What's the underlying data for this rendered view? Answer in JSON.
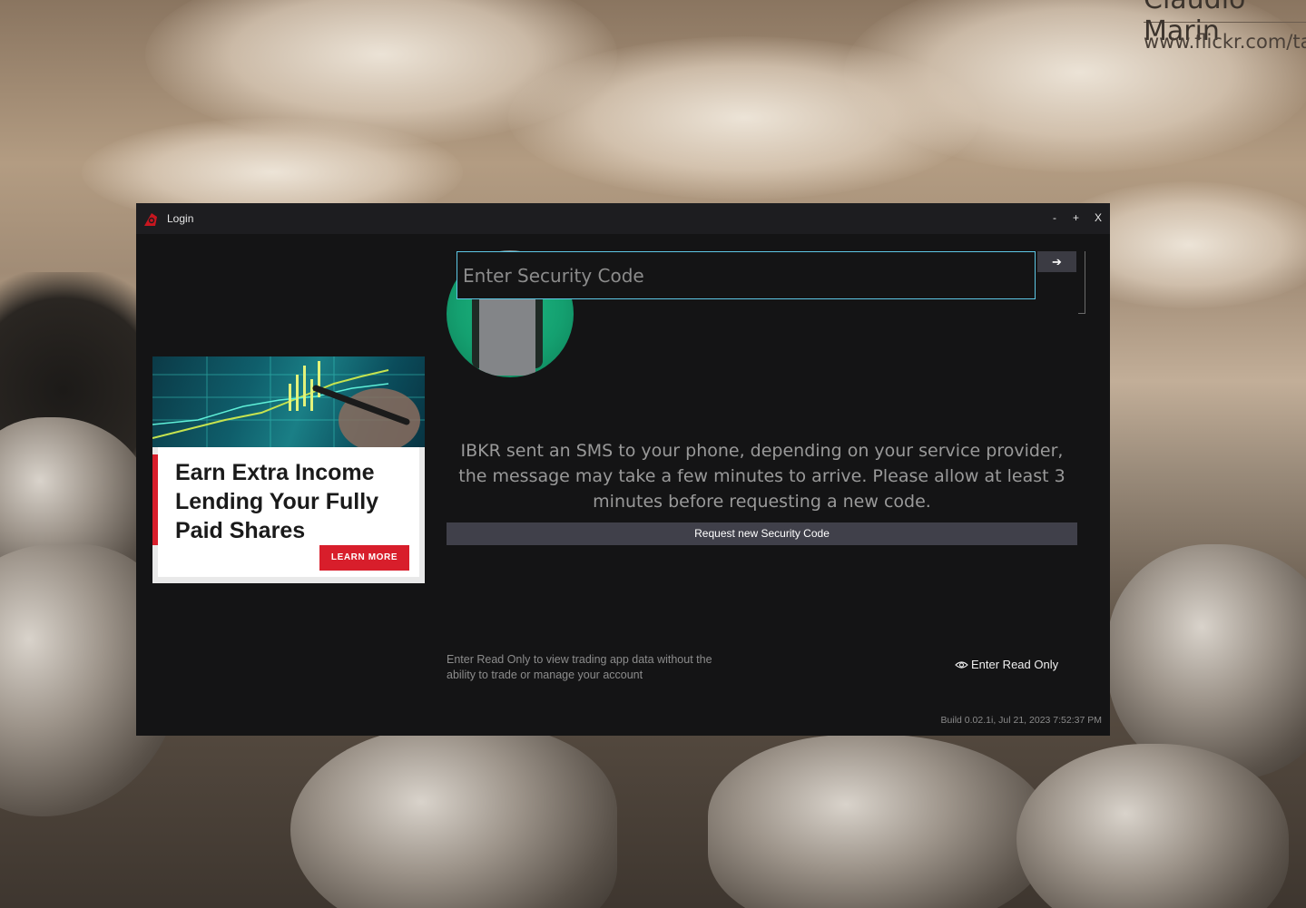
{
  "wallpaper": {
    "credit_name": "Claudio Marin",
    "credit_url": "www.flickr.com/ta"
  },
  "window": {
    "title": "Login",
    "logo_icon": "ibkr-logo-icon",
    "controls": {
      "minimize": "-",
      "maximize": "+",
      "close": "X"
    }
  },
  "ad": {
    "headline": "Earn Extra Income Lending Your Fully Paid Shares",
    "cta": "LEARN MORE",
    "accent_color": "#d81e2b"
  },
  "security": {
    "input_value": "",
    "input_placeholder": "Enter Security Code",
    "submit_glyph": "➔",
    "illustration_icon": "phone-sms-icon",
    "message": "IBKR sent an SMS to your phone, depending on your service provider, the message may take a few minutes to arrive. Please allow at least 3 minutes before requesting a new code.",
    "request_button": "Request new Security Code",
    "accent_color": "#5ec8e6"
  },
  "read_only": {
    "description": "Enter Read Only to view trading app data without the ability to trade or manage your account",
    "link_label": "Enter Read Only",
    "icon": "eye-icon"
  },
  "footer": {
    "build": "Build 0.02.1i, Jul 21, 2023 7:52:37 PM"
  }
}
